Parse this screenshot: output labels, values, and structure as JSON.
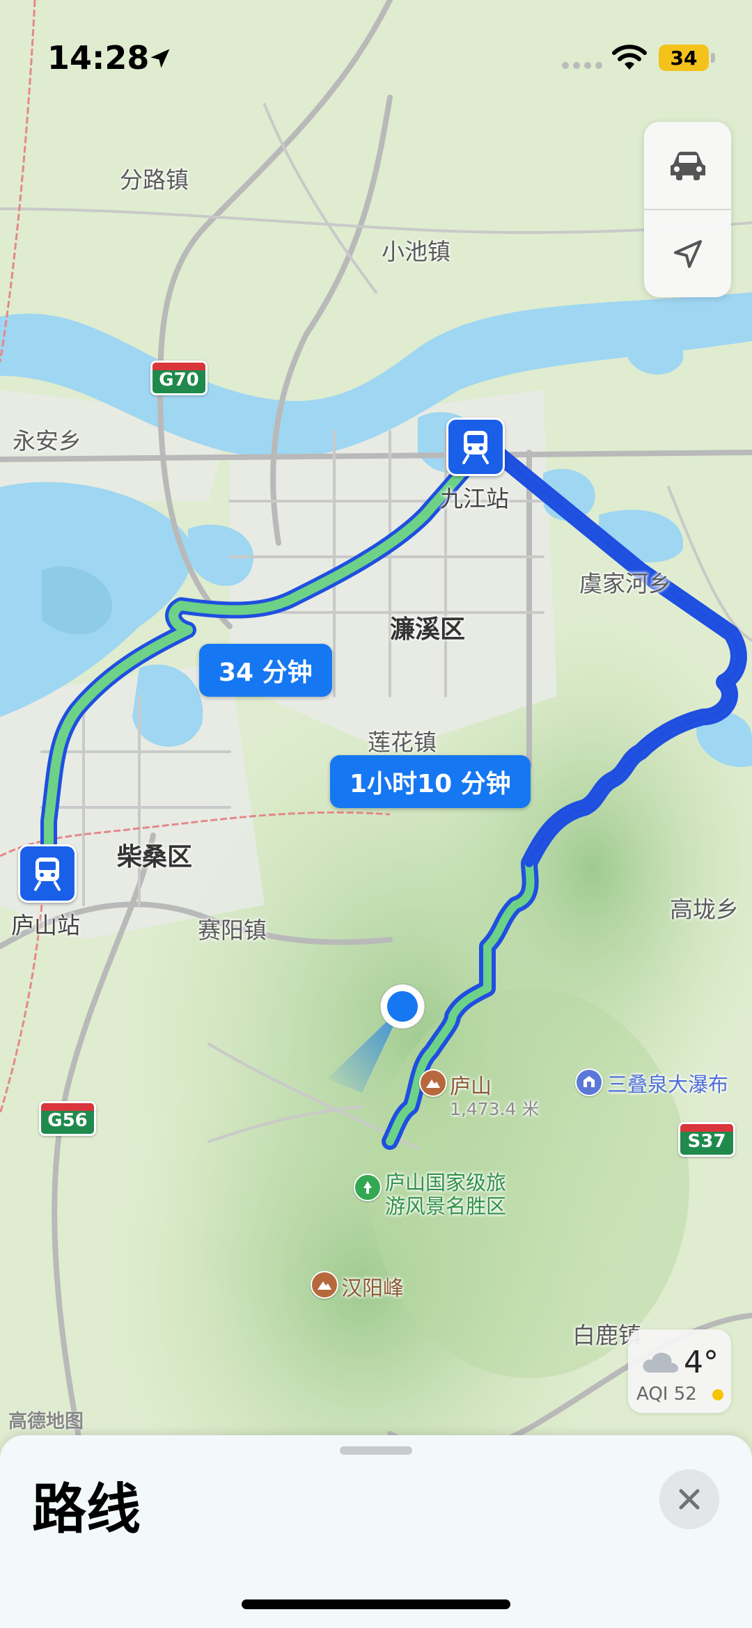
{
  "status_bar": {
    "time": "14:28",
    "battery": "34"
  },
  "map": {
    "places": {
      "fenluzhen": "分路镇",
      "xiaochizhen": "小池镇",
      "yonganxiang": "永安乡",
      "yujiahexiang": "虞家河乡",
      "lianhuazhen": "莲花镇",
      "saiyangzhen": "赛阳镇",
      "gaolongxiang": "高垅乡",
      "bailuzhen": "白鹿镇"
    },
    "districts": {
      "lianxi": "濂溪区",
      "chaisang": "柴桑区"
    },
    "highways": {
      "g70": "G70",
      "g56": "G56",
      "s37": "S37"
    },
    "stations": {
      "jiujiang": "九江站",
      "lushan": "庐山站"
    },
    "route_bubbles": {
      "green_route": "34 分钟",
      "blue_route": "1小时10 分钟"
    },
    "pois": {
      "lushan_peak_name": "庐山",
      "lushan_peak_elevation": "1,473.4 米",
      "sandiequan": "三叠泉大瀑布",
      "scenic_area_line1": "庐山国家级旅",
      "scenic_area_line2": "游风景名胜区",
      "hanyangfeng": "汉阳峰"
    },
    "attribution": "高德地图",
    "colors": {
      "water": "#9fd6f2",
      "land": "#dfeccf",
      "urban": "#e9ebe8",
      "green_route": "#6ed188",
      "blue_route": "#1f4fe0",
      "location_dot": "#1677f2"
    }
  },
  "weather": {
    "temperature": "4°",
    "aqi": "AQI 52"
  },
  "sheet": {
    "title": "路线"
  }
}
